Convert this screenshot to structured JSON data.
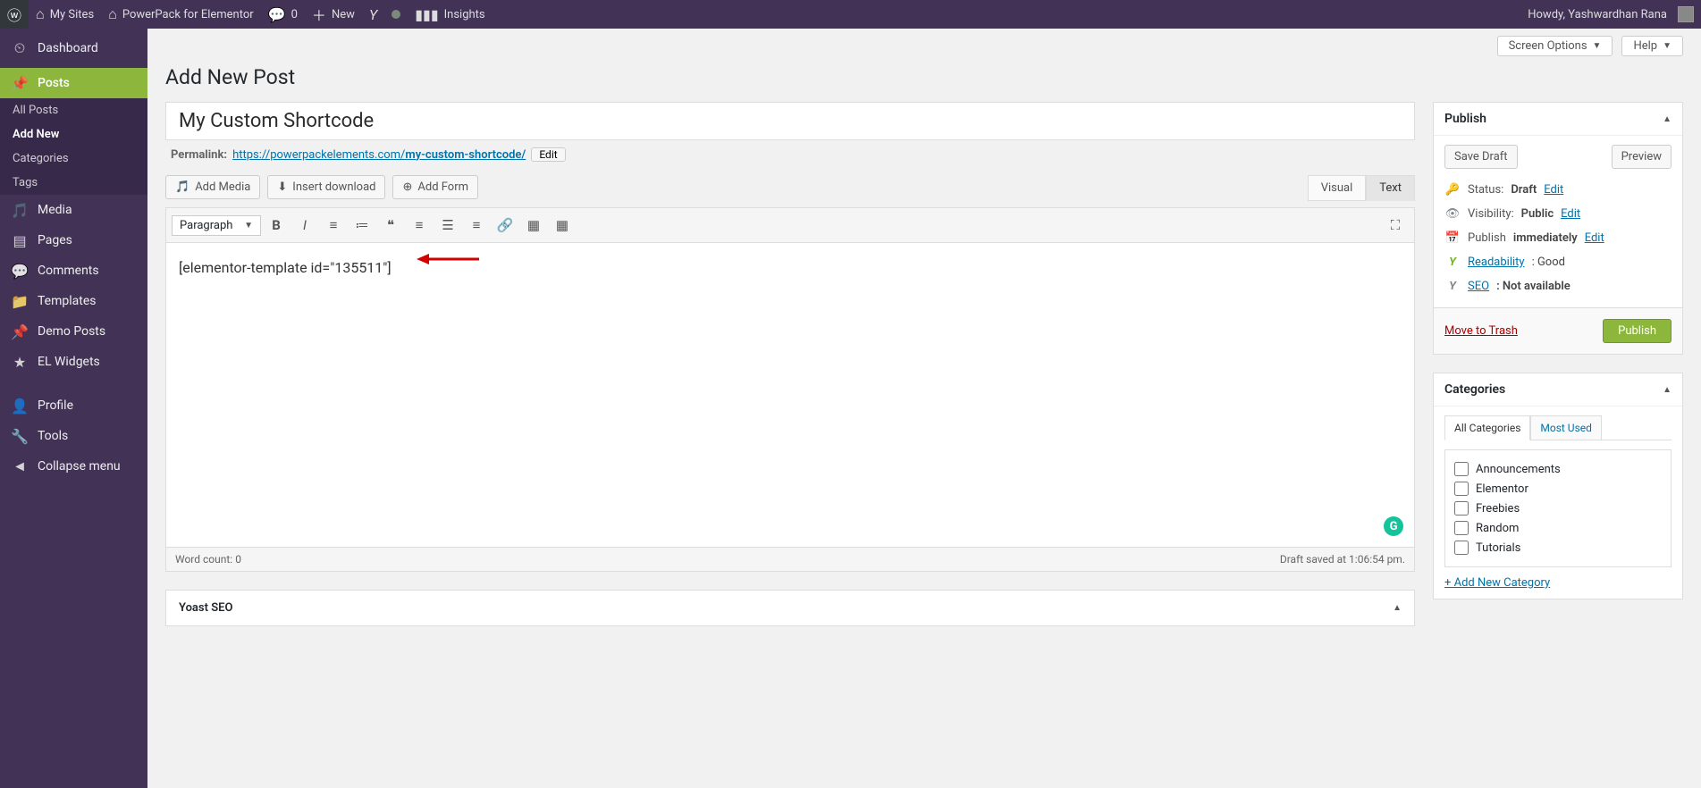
{
  "adminbar": {
    "mysites": "My Sites",
    "sitename": "PowerPack for Elementor",
    "comments": "0",
    "new": "New",
    "insights": "Insights",
    "howdy": "Howdy, Yashwardhan Rana"
  },
  "sidebar": {
    "dashboard": "Dashboard",
    "posts": "Posts",
    "posts_sub": {
      "all": "All Posts",
      "add": "Add New",
      "cats": "Categories",
      "tags": "Tags"
    },
    "media": "Media",
    "pages": "Pages",
    "comments": "Comments",
    "templates": "Templates",
    "demoposts": "Demo Posts",
    "elwidgets": "EL Widgets",
    "profile": "Profile",
    "tools": "Tools",
    "collapse": "Collapse menu"
  },
  "topbuttons": {
    "screen": "Screen Options",
    "help": "Help"
  },
  "page": {
    "title": "Add New Post",
    "post_title": "My Custom Shortcode",
    "permalink_label": "Permalink:",
    "permalink_base": "https://powerpackelements.com/",
    "permalink_slug": "my-custom-shortcode/",
    "permalink_edit": "Edit"
  },
  "mediabuttons": {
    "addmedia": "Add Media",
    "insertdl": "Insert download",
    "addform": "Add Form"
  },
  "editor_tabs": {
    "visual": "Visual",
    "text": "Text"
  },
  "editor": {
    "format": "Paragraph",
    "content": "[elementor-template id=\"135511\"]",
    "wordcount_label": "Word count: ",
    "wordcount": "0",
    "saved": "Draft saved at 1:06:54 pm."
  },
  "publish": {
    "title": "Publish",
    "savedraft": "Save Draft",
    "preview": "Preview",
    "status_label": "Status: ",
    "status_value": "Draft",
    "status_edit": "Edit",
    "vis_label": "Visibility: ",
    "vis_value": "Public",
    "vis_edit": "Edit",
    "sched_label": "Publish ",
    "sched_value": "immediately",
    "sched_edit": "Edit",
    "readability": "Readability",
    "readability_value": ": Good",
    "seo": "SEO",
    "seo_value": ": Not available",
    "trash": "Move to Trash",
    "publish": "Publish"
  },
  "categories": {
    "title": "Categories",
    "tab_all": "All Categories",
    "tab_used": "Most Used",
    "items": [
      "Announcements",
      "Elementor",
      "Freebies",
      "Random",
      "Tutorials"
    ],
    "addnew": "+ Add New Category"
  },
  "yoast": {
    "title": "Yoast SEO"
  }
}
